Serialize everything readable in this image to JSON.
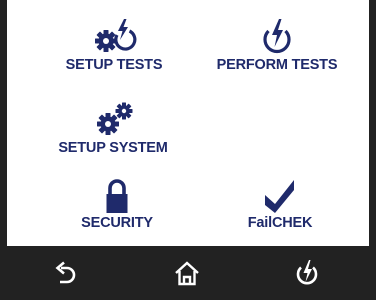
{
  "menu": {
    "setup_tests": {
      "label": "SETUP TESTS",
      "icon": "gear-bolt-icon"
    },
    "perform_tests": {
      "label": "PERFORM TESTS",
      "icon": "power-bolt-icon"
    },
    "setup_system": {
      "label": "SETUP SYSTEM",
      "icon": "gears-icon"
    },
    "security": {
      "label": "SECURITY",
      "icon": "padlock-icon"
    },
    "failchek": {
      "label": "FailCHEK",
      "icon": "checkmark-icon"
    }
  },
  "nav": {
    "back": {
      "icon": "back-arrow-icon"
    },
    "home": {
      "icon": "home-icon"
    },
    "power": {
      "icon": "power-icon"
    }
  },
  "colors": {
    "accent": "#1f2a6b",
    "panel": "#ffffff",
    "bar": "#222222",
    "nav_icon": "#ffffff"
  }
}
